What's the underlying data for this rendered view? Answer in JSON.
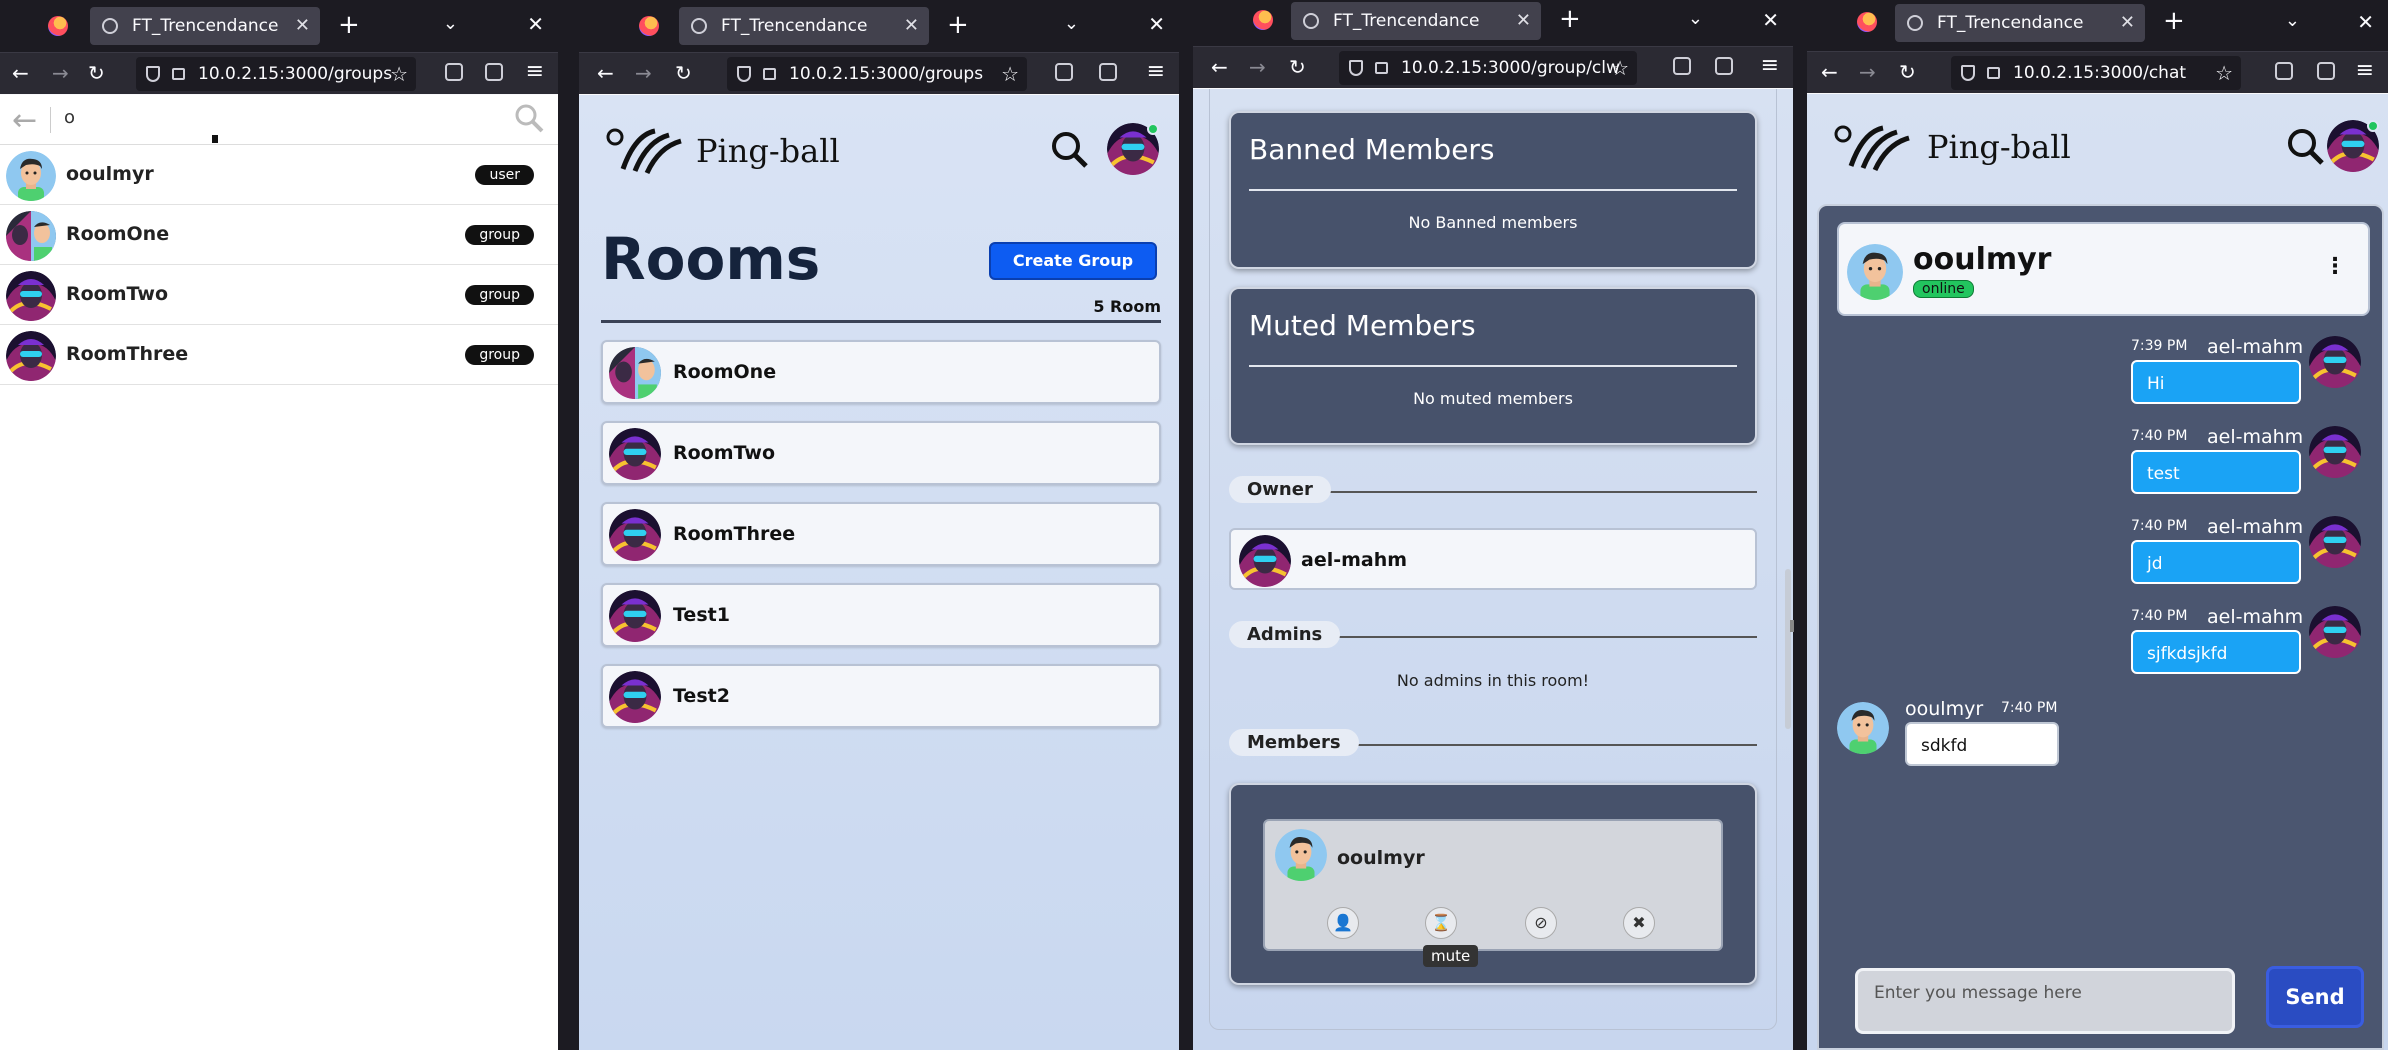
{
  "windows": [
    {
      "tab_title": "FT_Trencendance",
      "url": "10.0.2.15:3000/groups"
    },
    {
      "tab_title": "FT_Trencendance",
      "url": "10.0.2.15:3000/groups"
    },
    {
      "tab_title": "FT_Trencendance",
      "url": "10.0.2.15:3000/group/clw"
    },
    {
      "tab_title": "FT_Trencendance",
      "url": "10.0.2.15:3000/chat"
    }
  ],
  "search": {
    "query": "o",
    "results": [
      {
        "name": "ooulmyr",
        "type": "user"
      },
      {
        "name": "RoomOne",
        "type": "group"
      },
      {
        "name": "RoomTwo",
        "type": "group"
      },
      {
        "name": "RoomThree",
        "type": "group"
      }
    ]
  },
  "brand": "Ping-ball",
  "rooms": {
    "title": "Rooms",
    "create_label": "Create Group",
    "count_label": "5 Room",
    "items": [
      "RoomOne",
      "RoomTwo",
      "RoomThree",
      "Test1",
      "Test2"
    ]
  },
  "group": {
    "banned_title": "Banned Members",
    "banned_empty": "No Banned members",
    "muted_title": "Muted Members",
    "muted_empty": "No muted members",
    "owner_label": "Owner",
    "owner_name": "ael-mahm",
    "admins_label": "Admins",
    "admins_empty": "No admins in this room!",
    "members_label": "Members",
    "member_name": "ooulmyr",
    "tooltip": "mute"
  },
  "chat": {
    "contact": "ooulmyr",
    "status": "online",
    "messages": [
      {
        "time": "7:39 PM",
        "author": "ael-mahm",
        "text": "Hi"
      },
      {
        "time": "7:40 PM",
        "author": "ael-mahm",
        "text": "test"
      },
      {
        "time": "7:40 PM",
        "author": "ael-mahm",
        "text": "jd"
      },
      {
        "time": "7:40 PM",
        "author": "ael-mahm",
        "text": "sjfkdsjkfd"
      },
      {
        "time": "7:40 PM",
        "author": "ooulmyr",
        "text": "sdkfd"
      }
    ],
    "input_placeholder": "Enter you message here",
    "send_label": "Send"
  },
  "colors": {
    "accent": "#0d5cf2",
    "online": "#22c55e",
    "panel": "#47526b",
    "bubble": "#1aa3f5"
  }
}
